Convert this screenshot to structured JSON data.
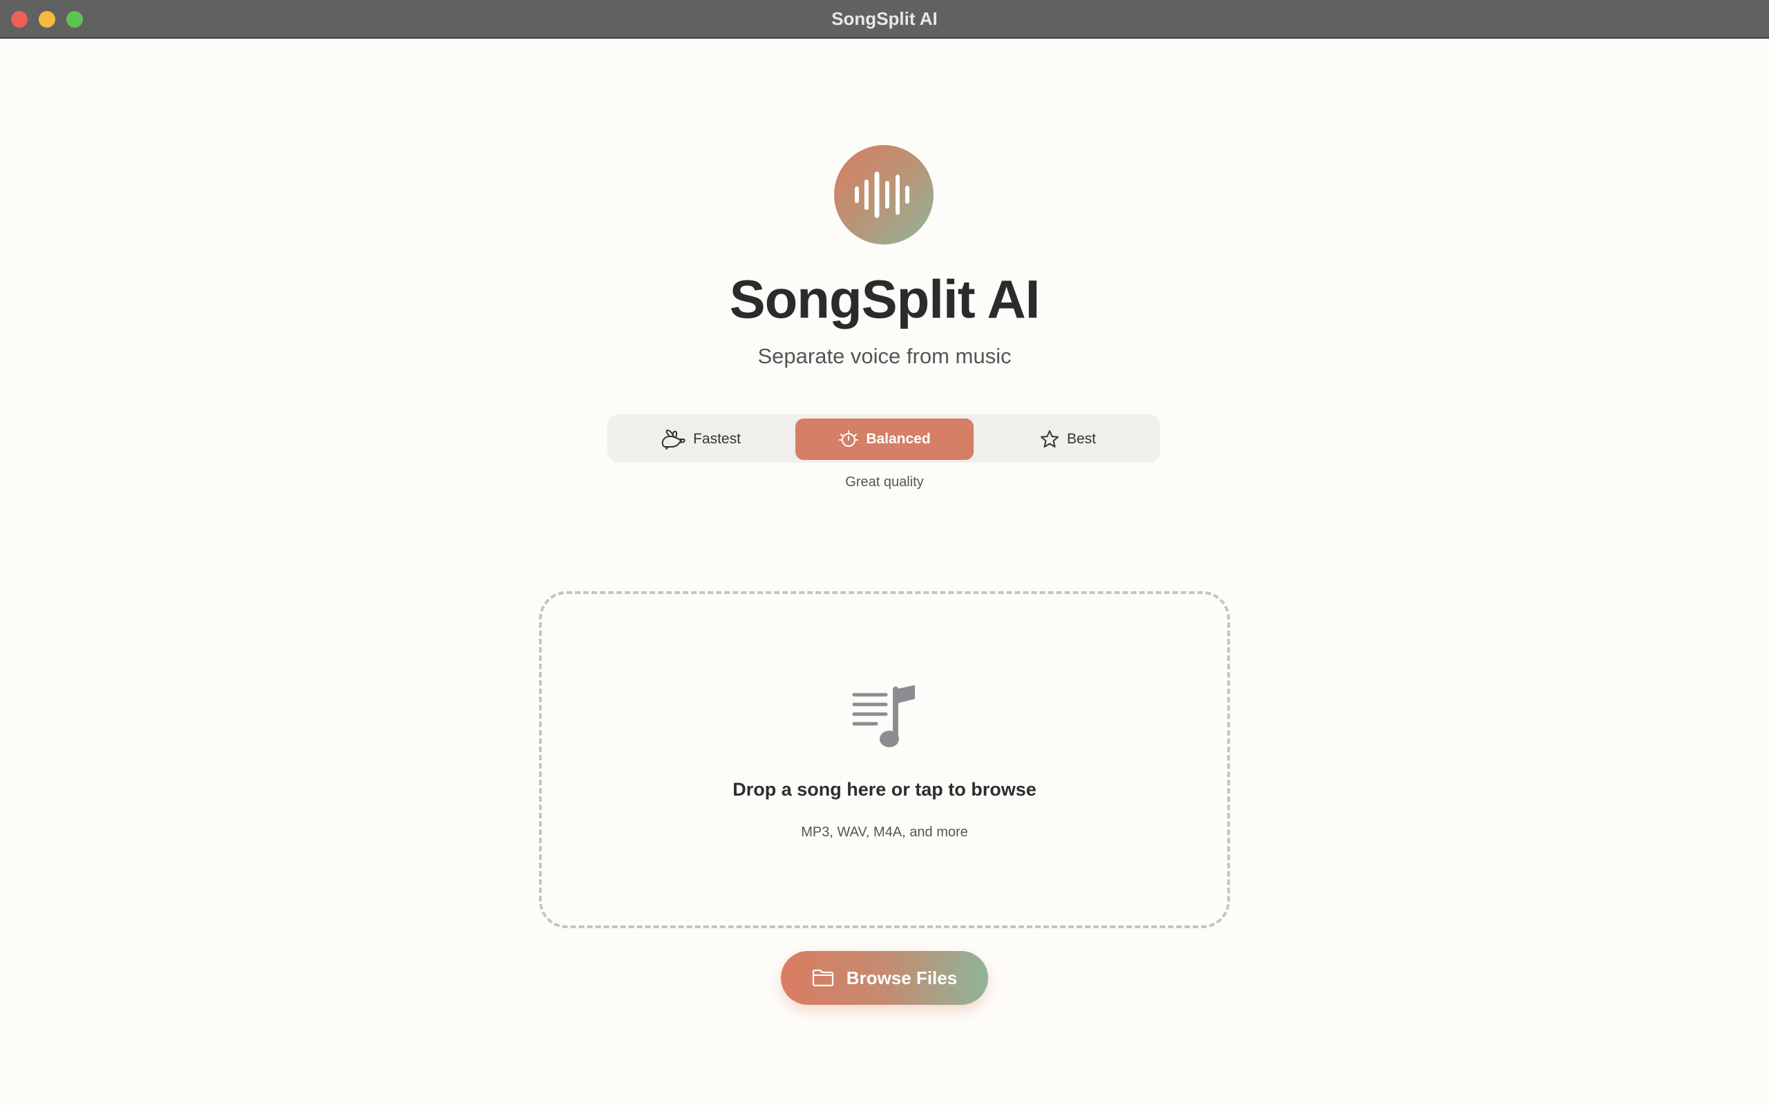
{
  "window": {
    "title": "SongSplit AI"
  },
  "header": {
    "logo_icon": "waveform-icon",
    "title": "SongSplit AI",
    "subtitle": "Separate voice from music"
  },
  "quality_modes": {
    "options": [
      {
        "label": "Fastest",
        "icon": "hare-icon"
      },
      {
        "label": "Balanced",
        "icon": "timer-icon"
      },
      {
        "label": "Best",
        "icon": "star-icon"
      }
    ],
    "selected": "Balanced",
    "description": "Great quality"
  },
  "dropzone": {
    "icon": "music-note-list-icon",
    "title": "Drop a song here or tap to browse",
    "subtitle": "MP3, WAV, M4A, and more"
  },
  "browse_button": {
    "label": "Browse Files",
    "icon": "folder-icon"
  },
  "colors": {
    "accent": "#d47f66",
    "gradient_start": "#d97d62",
    "gradient_end": "#8fb69a",
    "background": "#fefcf9"
  }
}
